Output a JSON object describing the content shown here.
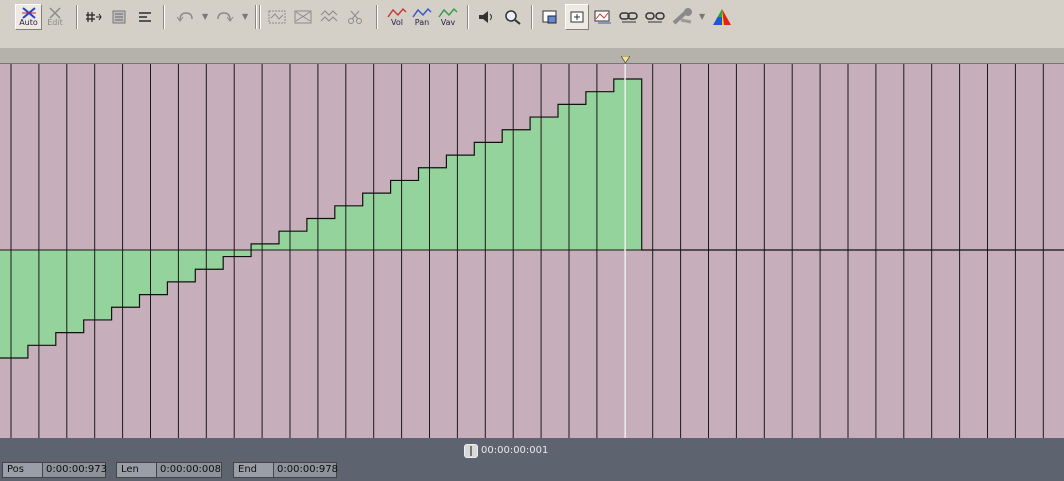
{
  "toolbar": {
    "auto_caption": "Auto",
    "edit_caption": "Edit",
    "vol_caption": "Vol",
    "pan_caption": "Pan",
    "vav_caption": "Vav"
  },
  "timeline": {
    "position_readout": "00:00:00:001"
  },
  "envelope": {
    "steps_before_cursor": 23,
    "start_level": -0.6,
    "end_level": 0.95,
    "baseline_level": 0
  },
  "status": {
    "pos_label": "Pos",
    "pos_value": "0:00:00:973",
    "len_label": "Len",
    "len_value": "0:00:00:008",
    "end_label": "End",
    "end_value": "0:00:00:978"
  },
  "colors": {
    "track_bg": "#c6afbb",
    "envelope_fill": "#95d39c",
    "grid_line": "#1a1a1a",
    "cursor_line": "#ffffff",
    "status_bg": "#5d6470"
  }
}
